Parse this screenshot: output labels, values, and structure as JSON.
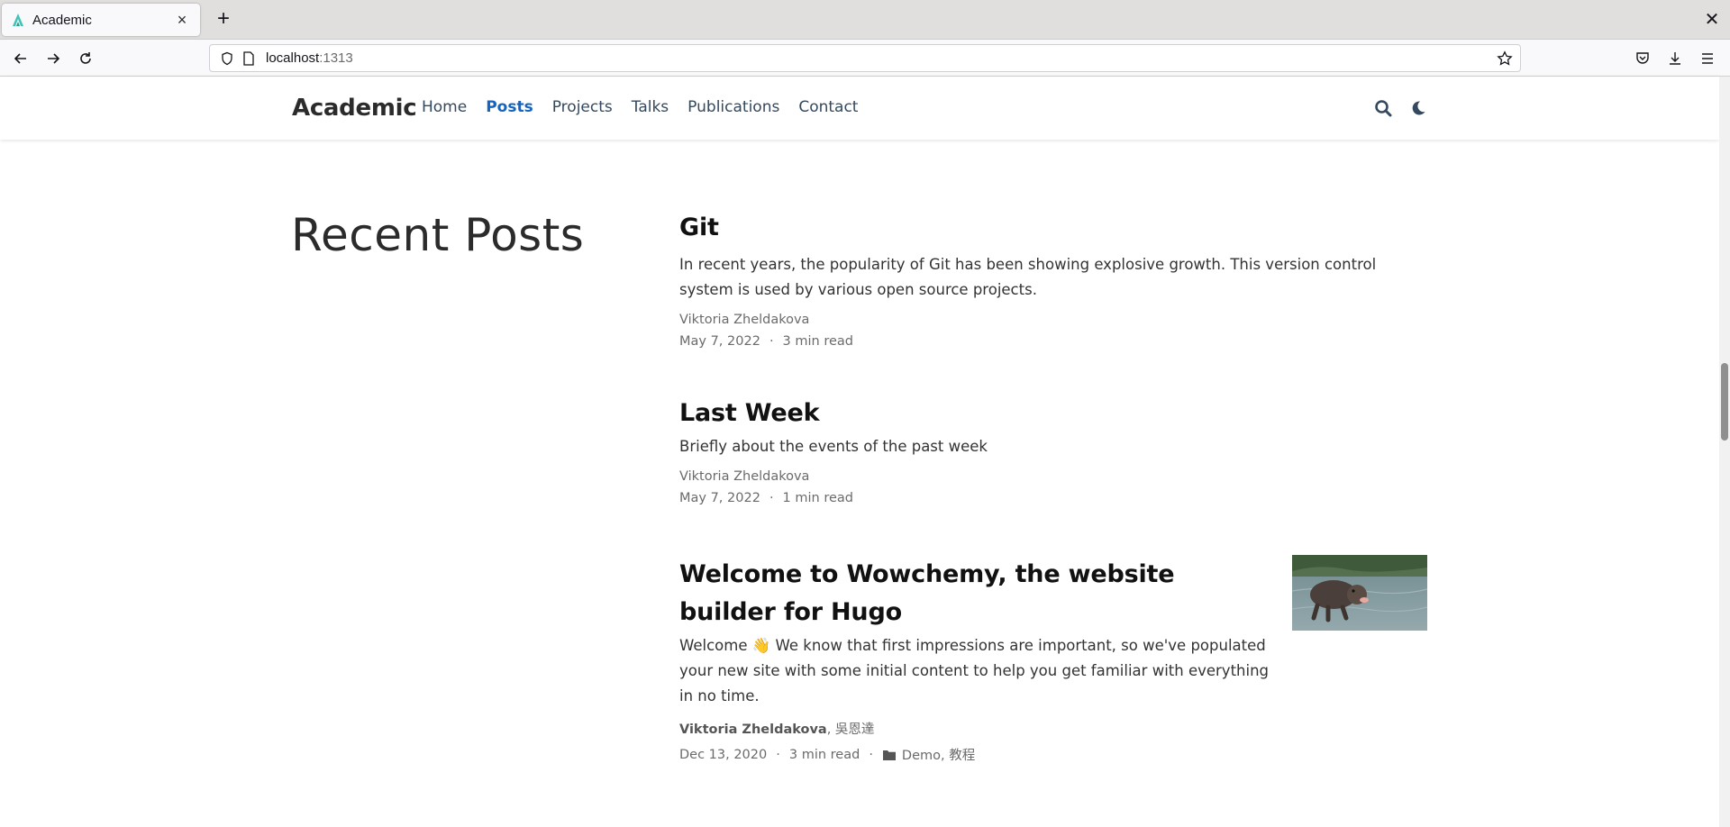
{
  "browser": {
    "tab_title": "Academic",
    "url_host": "localhost",
    "url_port": ":1313"
  },
  "site": {
    "brand": "Academic",
    "nav": [
      {
        "label": "Home",
        "active": false
      },
      {
        "label": "Posts",
        "active": true
      },
      {
        "label": "Projects",
        "active": false
      },
      {
        "label": "Talks",
        "active": false
      },
      {
        "label": "Publications",
        "active": false
      },
      {
        "label": "Contact",
        "active": false
      }
    ],
    "accent_color": "#1565c0"
  },
  "main": {
    "heading": "Recent Posts",
    "posts": [
      {
        "title": "Git",
        "summary": "In recent years, the popularity of Git has been showing explosive growth. This version control system is used by various open source projects.",
        "author": "Viktoria Zheldakova",
        "date": "May 7, 2022",
        "read_time": "3 min read"
      },
      {
        "title": "Last Week",
        "summary": "Briefly about the events of the past week",
        "author": "Viktoria Zheldakova",
        "date": "May 7, 2022",
        "read_time": "1 min read"
      },
      {
        "title": "Welcome to Wowchemy, the website builder for Hugo",
        "summary_prefix": "Welcome ",
        "summary_emoji": "👋",
        "summary_rest": " We know that first impressions are important, so we've populated your new site with some initial content to help you get familiar with everything in no time.",
        "author_primary": "Viktoria Zheldakova",
        "author_secondary": ", 吳恩達",
        "date": "Dec 13, 2020",
        "read_time": "3 min read",
        "categories": "Demo, 教程"
      }
    ]
  },
  "meta_separator": "·"
}
